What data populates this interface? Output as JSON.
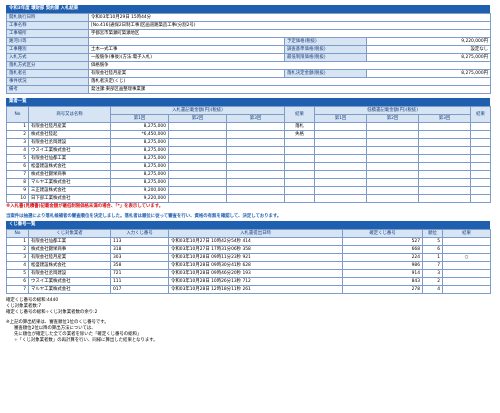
{
  "title": "令和3年度 壌財部 契約課 入札結果",
  "info": [
    {
      "label": "開札執行日時",
      "value": "令和03年10月29日 15時44分"
    },
    {
      "label": "工事名称",
      "value": "[No.416]通保2日制工事]区画道路築造工事(分割2号)"
    },
    {
      "label": "工事場所",
      "value": "宇都宮市築瀬町築瀬地区"
    },
    {
      "label": "路河川等",
      "value": "",
      "label2": "予定価格(税抜)",
      "value2": "9,220,000円"
    },
    {
      "label": "工事種別",
      "value": "土木一式工事",
      "label2": "調査基準価格(税抜)",
      "value2": "設定なし"
    },
    {
      "label": "入札方式",
      "value": "一般競争(事後)(方法:電子入札)",
      "label2": "最低制限価格(税抜)",
      "value2": "8,275,000円"
    },
    {
      "label": "落札方式区分",
      "value": "価格競争"
    },
    {
      "label": "落札者名",
      "value": "有限会社陸月産業",
      "label2": "落札決定金額(税抜)",
      "value2": "8,275,000円"
    },
    {
      "label": "事件状況",
      "value": "落札者決定(くじ)"
    },
    {
      "label": "備考",
      "value": "発注課:東部区画整理事業課"
    }
  ],
  "bidders_section": "業者一覧",
  "bidders_headers": {
    "no": "No",
    "name": "商号又は名称",
    "amount_group": "入札書記載金額(円)(税抜)",
    "round1": "第1回",
    "round2": "第2回",
    "round3": "第3回",
    "result": "結果",
    "low_amount_group": "低積書記載金額(円)(税抜)",
    "result2": "結果"
  },
  "bidders": [
    {
      "no": "1",
      "name": "有限会社陸月産業",
      "r1": "8,275,000",
      "result": "落札"
    },
    {
      "no": "2",
      "name": "株式会社陸起",
      "r1": "*6,450,000",
      "result": "失格"
    },
    {
      "no": "3",
      "name": "有限会社丞岡建設",
      "r1": "8,275,000",
      "result": ""
    },
    {
      "no": "4",
      "name": "ウスイ工業株式会社",
      "r1": "8,275,000",
      "result": ""
    },
    {
      "no": "5",
      "name": "有限会社仙都工業",
      "r1": "8,275,000",
      "result": ""
    },
    {
      "no": "6",
      "name": "松盛建設株式会社",
      "r1": "8,275,000",
      "result": ""
    },
    {
      "no": "7",
      "name": "株式会社錦栄商事",
      "r1": "8,275,000",
      "result": ""
    },
    {
      "no": "8",
      "name": "マルヤ工業株式会社",
      "r1": "8,275,000",
      "result": ""
    },
    {
      "no": "9",
      "name": "三正建設株式会社",
      "r1": "9,200,000",
      "result": ""
    },
    {
      "no": "10",
      "name": "日下部工業株式会社",
      "r1": "9,220,000",
      "result": ""
    }
  ],
  "note_red": "※入札書(見積書)記載金額が最低制限価格未満の場合、「*」を表示しています。",
  "note_blue": "当案件は抽選により落札候補者の審査順位を決定しました。落札者は順位に従って審査を行い、資格の有無を確認して、決定しております。",
  "lottery_section": "くじ番号一覧",
  "lottery_headers": {
    "no": "No",
    "name": "くじ対象業者",
    "kuji": "入力くじ番号",
    "time": "入札書提出日時",
    "final": "確定くじ番号",
    "rank": "順位",
    "result": "結果"
  },
  "lottery": [
    {
      "no": "1",
      "name": "有限会社仙都工業",
      "kuji": "113",
      "time": "令和03年10月27日 10時42分54秒 414",
      "final": "527",
      "rank": "5",
      "result": ""
    },
    {
      "no": "2",
      "name": "株式会社錦栄商事",
      "kuji": "318",
      "time": "令和03年10月27日 17時31分06秒 358",
      "final": "668",
      "rank": "6",
      "result": ""
    },
    {
      "no": "3",
      "name": "有限会社陸月産業",
      "kuji": "303",
      "time": "令和03年10月28日 09時11分23秒 921",
      "final": "224",
      "rank": "1",
      "result": "○"
    },
    {
      "no": "4",
      "name": "松盛建設株式会社",
      "kuji": "358",
      "time": "令和03年10月28日 09時30分41秒 628",
      "final": "986",
      "rank": "7",
      "result": ""
    },
    {
      "no": "5",
      "name": "有限会社丞岡建設",
      "kuji": "721",
      "time": "令和03年10月28日 09時46分20秒 193",
      "final": "914",
      "rank": "3",
      "result": ""
    },
    {
      "no": "6",
      "name": "ウスイ工業株式会社",
      "kuji": "111",
      "time": "令和03年10月28日 10時26分13秒 712",
      "final": "843",
      "rank": "2",
      "result": ""
    },
    {
      "no": "7",
      "name": "マルヤ工業株式会社",
      "kuji": "017",
      "time": "令和03年10月28日 12時18分11秒 261",
      "final": "278",
      "rank": "4",
      "result": ""
    }
  ],
  "summary": [
    "確定くじ番号の総和:4440",
    "くじ対象業者数:7",
    "確定くじ番号の総和÷くじ対象業者数の余り:2"
  ],
  "footnote": [
    "※上記の算出結果は、審査順位1位のくじ番号です。",
    "審査順位2位以降の算出方法については、",
    "先に順位が確定した全ての業者を除いた「確定くじ番号の総和」",
    "÷「くじ対象業者数」の再計算を行い、同様に算出した結果となります。"
  ]
}
